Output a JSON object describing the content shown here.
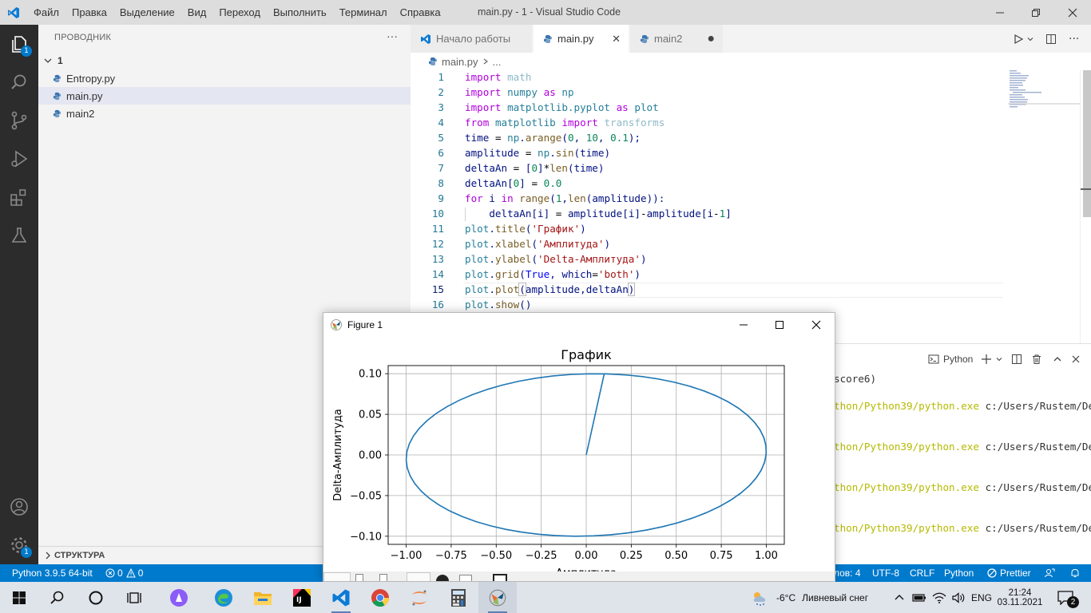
{
  "window": {
    "title": "main.py - 1 - Visual Studio Code",
    "menu": [
      "Файл",
      "Правка",
      "Выделение",
      "Вид",
      "Переход",
      "Выполнить",
      "Терминал",
      "Справка"
    ]
  },
  "activity_bar": {
    "explorer_badge": "1",
    "settings_badge": "1"
  },
  "sidebar": {
    "header": "ПРОВОДНИК",
    "folder": "1",
    "files": [
      "Entropy.py",
      "main.py",
      "main2"
    ],
    "outline": "СТРУКТУРА"
  },
  "tabs": [
    {
      "label": "Начало работы"
    },
    {
      "label": "main.py"
    },
    {
      "label": "main2"
    }
  ],
  "breadcrumb": {
    "file": "main.py",
    "rest": "..."
  },
  "editor": {
    "line_numbers": [
      "1",
      "2",
      "3",
      "4",
      "5",
      "6",
      "7",
      "8",
      "9",
      "10",
      "11",
      "12",
      "13",
      "14",
      "15",
      "16"
    ],
    "current_line": 15
  },
  "terminal": {
    "shell_label": "Python",
    "lines": [
      {
        "yellow": "",
        "text": "score6)"
      },
      {
        "yellow": "thon/Python39/python.exe",
        "text": " c:/Users/Rustem/De"
      },
      {
        "yellow": "thon/Python39/python.exe",
        "text": " c:/Users/Rustem/De"
      },
      {
        "yellow": "thon/Python39/python.exe",
        "text": " c:/Users/Rustem/De"
      },
      {
        "yellow": "thon/Python39/python.exe",
        "text": " c:/Users/Rustem/De"
      }
    ]
  },
  "statusbar": {
    "interpreter": "Python 3.9.5 64-bit",
    "errors": "0",
    "warnings": "0",
    "spaces": "лов: 4",
    "encoding": "UTF-8",
    "eol": "CRLF",
    "language": "Python",
    "formatter": "Prettier"
  },
  "figure": {
    "window_title": "Figure 1",
    "chart_data": {
      "type": "line",
      "title": "График",
      "xlabel": "Амплитуда",
      "ylabel": "Delta-Амплитуда",
      "xlim": [
        -1.1,
        1.1
      ],
      "ylim": [
        -0.11,
        0.11
      ],
      "x_ticks": [
        "−1.00",
        "−0.75",
        "−0.50",
        "−0.25",
        "0.00",
        "0.25",
        "0.50",
        "0.75",
        "1.00"
      ],
      "x_tick_values": [
        -1.0,
        -0.75,
        -0.5,
        -0.25,
        0.0,
        0.25,
        0.5,
        0.75,
        1.0
      ],
      "y_ticks": [
        "0.10",
        "0.05",
        "0.00",
        "−0.05",
        "−0.10"
      ],
      "y_tick_values": [
        0.1,
        0.05,
        0.0,
        -0.05,
        -0.1
      ],
      "grid": true,
      "line_color": "#1f77b4",
      "series": [
        {
          "start": 0,
          "stop": 10,
          "step": 0.1,
          "x_expr": "sin(t)",
          "y_expr": "delta of sin(t)"
        }
      ]
    }
  },
  "taskbar": {
    "weather_temp": "-6°C",
    "weather_text": "Ливневый снег",
    "lang": "ENG",
    "time": "21:24",
    "date": "03.11.2021",
    "notifications": "2"
  }
}
